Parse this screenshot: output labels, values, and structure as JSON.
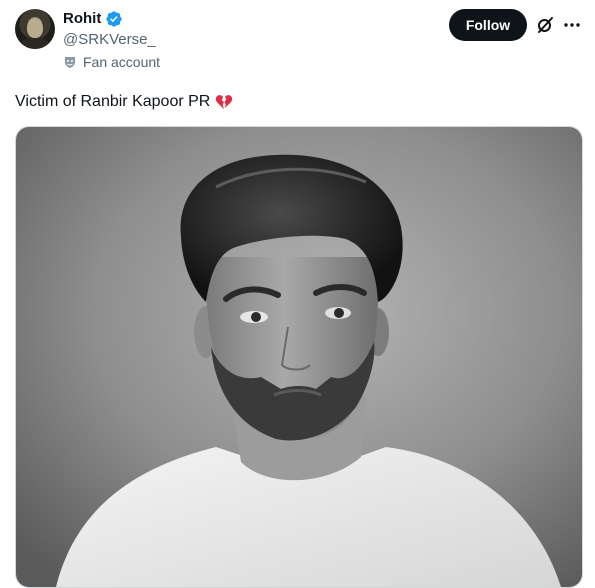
{
  "user": {
    "display_name": "Rohit",
    "handle": "@SRKVerse_",
    "label": "Fan account",
    "verified": true,
    "verified_color": "#1d9bf0"
  },
  "actions": {
    "follow_label": "Follow",
    "follow_bg": "#0f1419",
    "grok_icon": "grok-icon",
    "more_icon": "more-icon"
  },
  "tweet": {
    "text": "Victim of Ranbir Kapoor PR",
    "emoji": "broken-heart-icon",
    "emoji_color": "#dd2e44"
  },
  "media": {
    "type": "photo",
    "style": "black-and-white portrait"
  }
}
